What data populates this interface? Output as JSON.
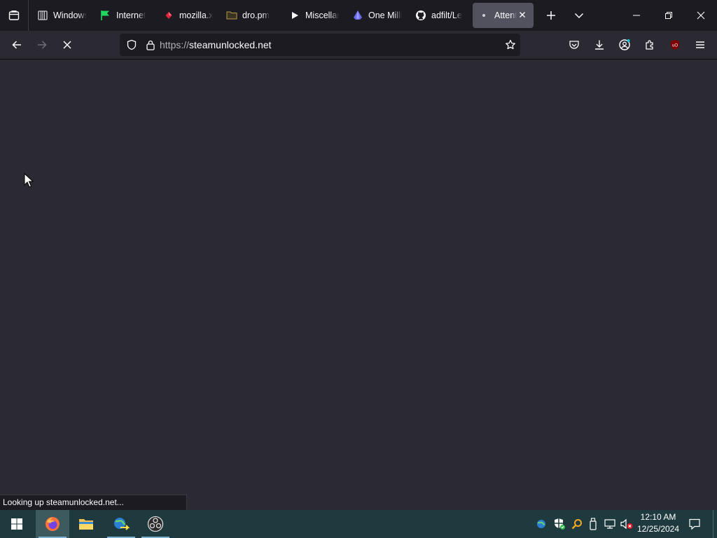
{
  "browser": {
    "tabs": [
      {
        "label": "Windows",
        "icon": "columns-icon",
        "active": false
      },
      {
        "label": "Internet",
        "icon": "green-flag-icon",
        "active": false
      },
      {
        "label": "mozilla.xyz",
        "icon": "red-gem-icon",
        "active": false
      },
      {
        "label": "dro.pm",
        "icon": "folder-icon",
        "active": false
      },
      {
        "label": "Miscellaneous",
        "icon": "play-icon",
        "active": false
      },
      {
        "label": "One Million",
        "icon": "blue-logo-icon",
        "active": false
      },
      {
        "label": "adfilt/Le",
        "icon": "github-icon",
        "active": false
      },
      {
        "label": "Attention Required",
        "icon": "loading-dot-icon",
        "active": true
      }
    ],
    "url": {
      "protocol": "https://",
      "host": "steamunlocked.net"
    },
    "status_text": "Looking up steamunlocked.net..."
  },
  "taskbar": {
    "apps": [
      {
        "name": "firefox",
        "icon": "firefox-icon"
      },
      {
        "name": "file-explorer",
        "icon": "folder-icon"
      },
      {
        "name": "network-tool",
        "icon": "globe-network-icon"
      },
      {
        "name": "obs",
        "icon": "obs-icon"
      }
    ],
    "clock": {
      "time": "12:10 AM",
      "date": "12/25/2024"
    }
  },
  "colors": {
    "toolbar": "#2b2a33",
    "tabstrip": "#1c1b22",
    "active_tab": "#52525e",
    "taskbar": "#1f3a3e"
  }
}
